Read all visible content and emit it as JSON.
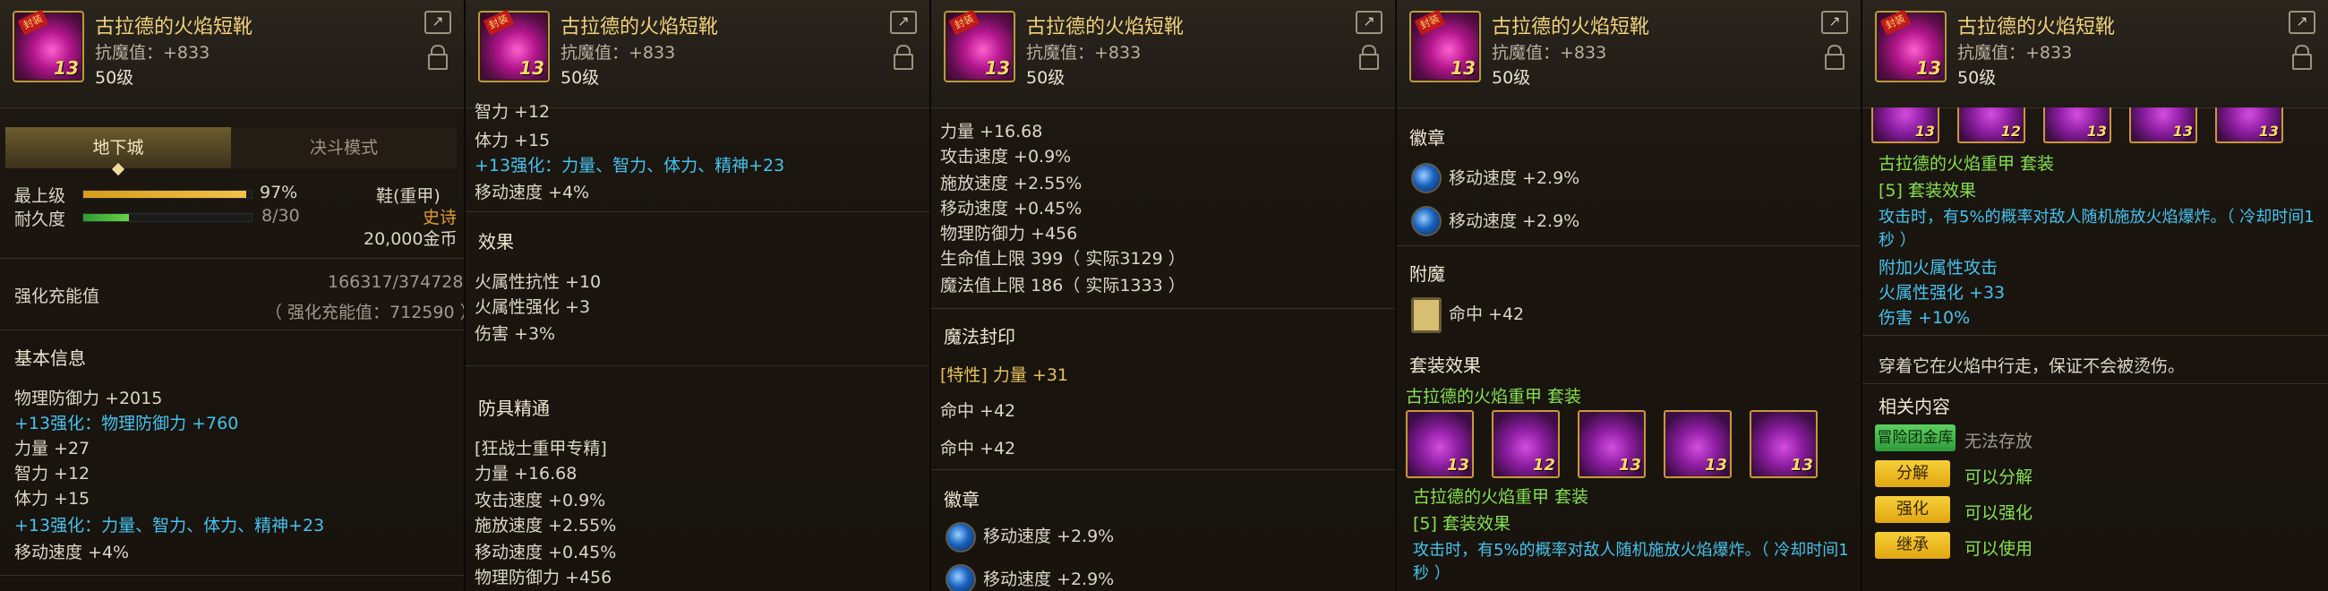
{
  "item": {
    "name": "古拉德的火焰短靴",
    "anti_magic": "抗魔值：+833",
    "level": "50级",
    "thumb_tag": "封装",
    "thumb_level": "13"
  },
  "panels": [
    {
      "tabs": [
        "地下城",
        "决斗模式"
      ],
      "stats": {
        "max_level_label": "最上级",
        "max_level_value": "97%",
        "durability_label": "耐久度",
        "durability_value": "8/30",
        "max_level_progress": 0.97,
        "durability_progress": 0.27,
        "slot": "鞋(重甲)",
        "rarity": "史诗",
        "price": "20,000金币"
      },
      "enhance": {
        "label": "强化充能值",
        "value": "166317/374728",
        "sub": "（ 强化充能值：712590 ）"
      },
      "base_title": "基本信息",
      "base_lines": [
        {
          "text": "物理防御力 +2015",
          "cls": ""
        },
        {
          "text": "+13强化：物理防御力 +760",
          "cls": "cyan"
        },
        {
          "text": "力量 +27",
          "cls": ""
        },
        {
          "text": "智力 +12",
          "cls": ""
        },
        {
          "text": "体力 +15",
          "cls": ""
        },
        {
          "text": "+13强化：力量、智力、体力、精神+23",
          "cls": "cyan"
        },
        {
          "text": "移动速度 +4%",
          "cls": ""
        }
      ]
    },
    {
      "top_lines": [
        {
          "text": "智力 +12",
          "cls": ""
        },
        {
          "text": "体力 +15",
          "cls": ""
        },
        {
          "text": "+13强化：力量、智力、体力、精神+23",
          "cls": "cyan"
        },
        {
          "text": "移动速度 +4%",
          "cls": ""
        }
      ],
      "effect_title": "效果",
      "effect_lines": [
        "火属性抗性 +10",
        "火属性强化 +3",
        "伤害 +3%"
      ],
      "mastery_title": "防具精通",
      "mastery_lines": [
        "[狂战士重甲专精]",
        "力量 +16.68",
        "攻击速度 +0.9%",
        "施放速度 +2.55%",
        "移动速度 +0.45%",
        "物理防御力 +456"
      ]
    },
    {
      "top_lines": [
        "力量 +16.68",
        "攻击速度 +0.9%",
        "施放速度 +2.55%",
        "移动速度 +0.45%",
        "物理防御力 +456",
        "生命值上限 399（ 实际3129 ）",
        "魔法值上限 186（ 实际1333 ）"
      ],
      "seal_title": "魔法封印",
      "seal_lines": [
        {
          "text": "[特性] 力量 +31",
          "cls": "gold"
        },
        {
          "text": "命中 +42",
          "cls": ""
        },
        {
          "text": "命中 +42",
          "cls": ""
        }
      ],
      "emblem_title": "徽章",
      "emblem_lines": [
        "移动速度 +2.9%",
        "移动速度 +2.9%"
      ]
    },
    {
      "emblem_title": "徽章",
      "emblem_lines": [
        "移动速度 +2.9%",
        "移动速度 +2.9%"
      ],
      "enchant_title": "附魔",
      "enchant_line": "命中 +42",
      "set_title": "套装效果",
      "set_name": "古拉德的火焰重甲 套装",
      "set_items": [
        {
          "level": "13"
        },
        {
          "level": "12"
        },
        {
          "level": "13"
        },
        {
          "level": "13"
        },
        {
          "level": "13"
        }
      ],
      "set_name2": "古拉德的火焰重甲 套装",
      "set_bonus_title": "[5] 套装效果",
      "set_bonus_line1": "攻击时，有5%的概率对敌人随机施放火焰爆炸。（ 冷却时间1",
      "set_bonus_line2": "秒 ）"
    },
    {
      "set_items": [
        {
          "level": "13"
        },
        {
          "level": "12"
        },
        {
          "level": "13"
        },
        {
          "level": "13"
        },
        {
          "level": "13"
        }
      ],
      "set_name": "古拉德的火焰重甲 套装",
      "set_bonus_title": "[5] 套装效果",
      "set_bonus_line1": "攻击时，有5%的概率对敌人随机施放火焰爆炸。（ 冷却时间1",
      "set_bonus_line2": "秒 ）",
      "extra_lines": [
        "附加火属性攻击",
        "火属性强化 +33",
        "伤害 +10%"
      ],
      "flavor": "穿着它在火焰中行走，保证不会被烫伤。",
      "related_title": "相关内容",
      "warehouse_badge": "冒险团金库",
      "warehouse_text": "无法存放",
      "actions": [
        {
          "label": "分解",
          "text": "可以分解"
        },
        {
          "label": "强化",
          "text": "可以强化"
        },
        {
          "label": "继承",
          "text": "可以使用"
        }
      ]
    }
  ]
}
